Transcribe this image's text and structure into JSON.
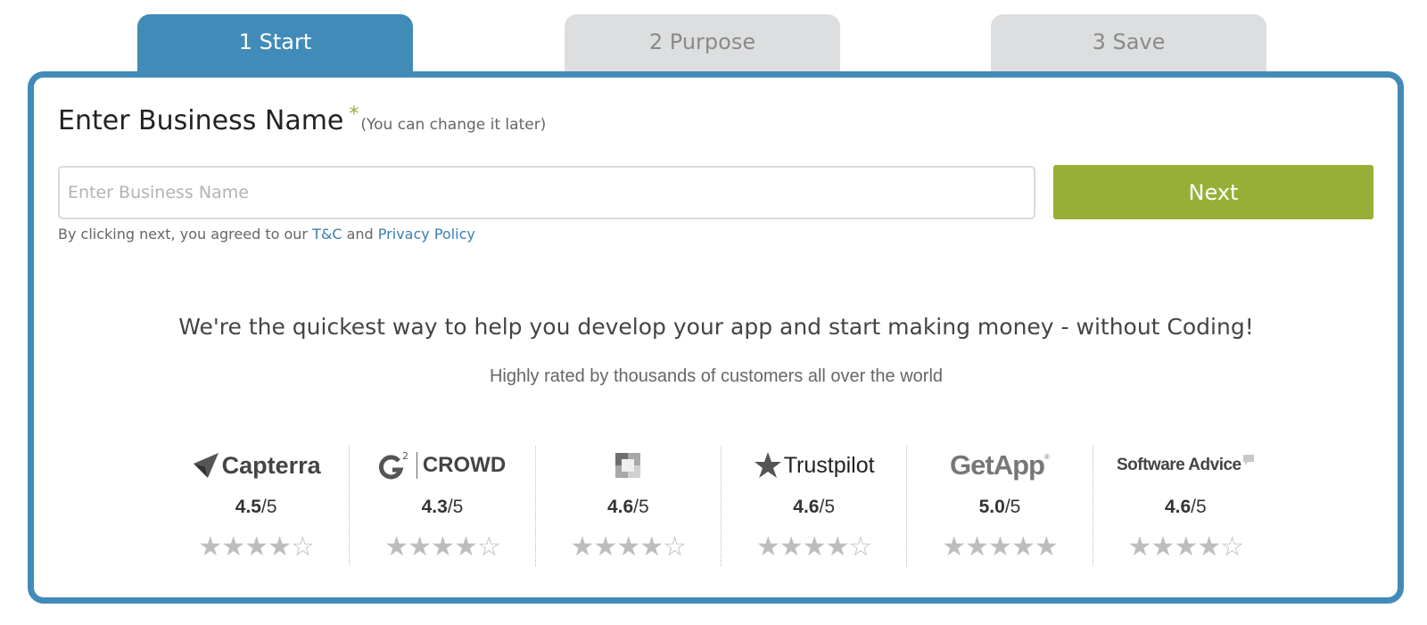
{
  "steps": [
    {
      "label": "1 Start",
      "active": true
    },
    {
      "label": "2 Purpose",
      "active": false
    },
    {
      "label": "3 Save",
      "active": false
    }
  ],
  "form": {
    "heading": "Enter Business Name",
    "required_mark": "*",
    "hint": "(You can change it later)",
    "input_placeholder": "Enter Business Name",
    "input_value": "",
    "next_label": "Next",
    "terms_prefix": "By clicking next, you agreed to our",
    "terms_link": "T&C",
    "terms_and": "and",
    "privacy_link": "Privacy Policy"
  },
  "tagline": "We're the quickest way to help you develop your app and start making money - without Coding!",
  "subtagline": "Highly rated by thousands of customers all over the world",
  "ratings": [
    {
      "brand": "Capterra",
      "logo_icon": "capterra-arrow-icon",
      "score": "4.5",
      "out_of": "/5",
      "stars": 4
    },
    {
      "brand": "CROWD",
      "logo_icon": "g2-icon",
      "score": "4.3",
      "out_of": "/5",
      "stars": 4
    },
    {
      "brand": "",
      "logo_icon": "square-grid-icon",
      "score": "4.6",
      "out_of": "/5",
      "stars": 4
    },
    {
      "brand": "Trustpilot",
      "logo_icon": "star-icon",
      "score": "4.6",
      "out_of": "/5",
      "stars": 4
    },
    {
      "brand": "GetApp",
      "logo_icon": "getapp-icon",
      "score": "5.0",
      "out_of": "/5",
      "stars": 5
    },
    {
      "brand": "Software Advice",
      "logo_icon": "speech-bubble-icon",
      "score": "4.6",
      "out_of": "/5",
      "stars": 4
    }
  ],
  "colors": {
    "accent_blue": "#418bb9",
    "inactive_tab": "#dcdedf",
    "next_green": "#98af37",
    "link_blue": "#3a7db3"
  }
}
